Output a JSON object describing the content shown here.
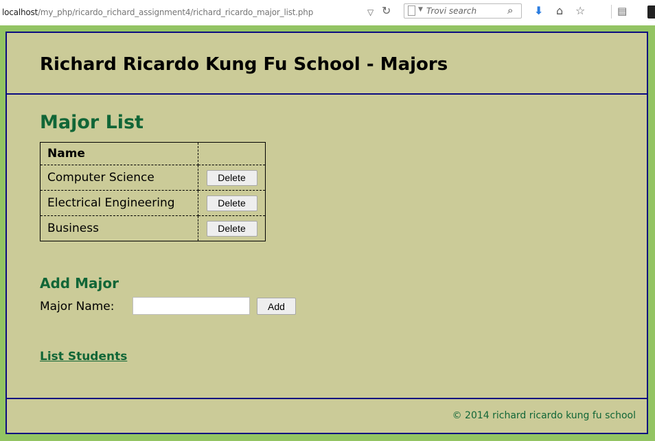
{
  "browser": {
    "url_host": "localhost",
    "url_path": "/my_php/ricardo_richard_assignment4/richard_ricardo_major_list.php",
    "search_placeholder": "Trovi search",
    "icons": [
      "dropdown-arrow-icon",
      "reload-icon",
      "page-icon",
      "search-icon",
      "download-icon",
      "home-icon",
      "bookmark-star-icon",
      "reading-list-icon"
    ]
  },
  "header": {
    "title": "Richard Ricardo Kung Fu School - Majors"
  },
  "main": {
    "list_title": "Major List",
    "table": {
      "headers": [
        "Name",
        ""
      ],
      "rows": [
        {
          "name": "Computer Science",
          "action": "Delete"
        },
        {
          "name": "Electrical Engineering",
          "action": "Delete"
        },
        {
          "name": "Business",
          "action": "Delete"
        }
      ]
    },
    "add_title": "Add Major",
    "major_name_label": "Major Name:",
    "major_name_value": "",
    "add_button": "Add",
    "list_students_link": "List Students"
  },
  "footer": {
    "text": "© 2014 richard ricardo kung fu school"
  },
  "colors": {
    "page_bg": "#93c463",
    "container_bg": "#cbcb98",
    "border": "#0b0b80",
    "heading_green": "#116637"
  }
}
